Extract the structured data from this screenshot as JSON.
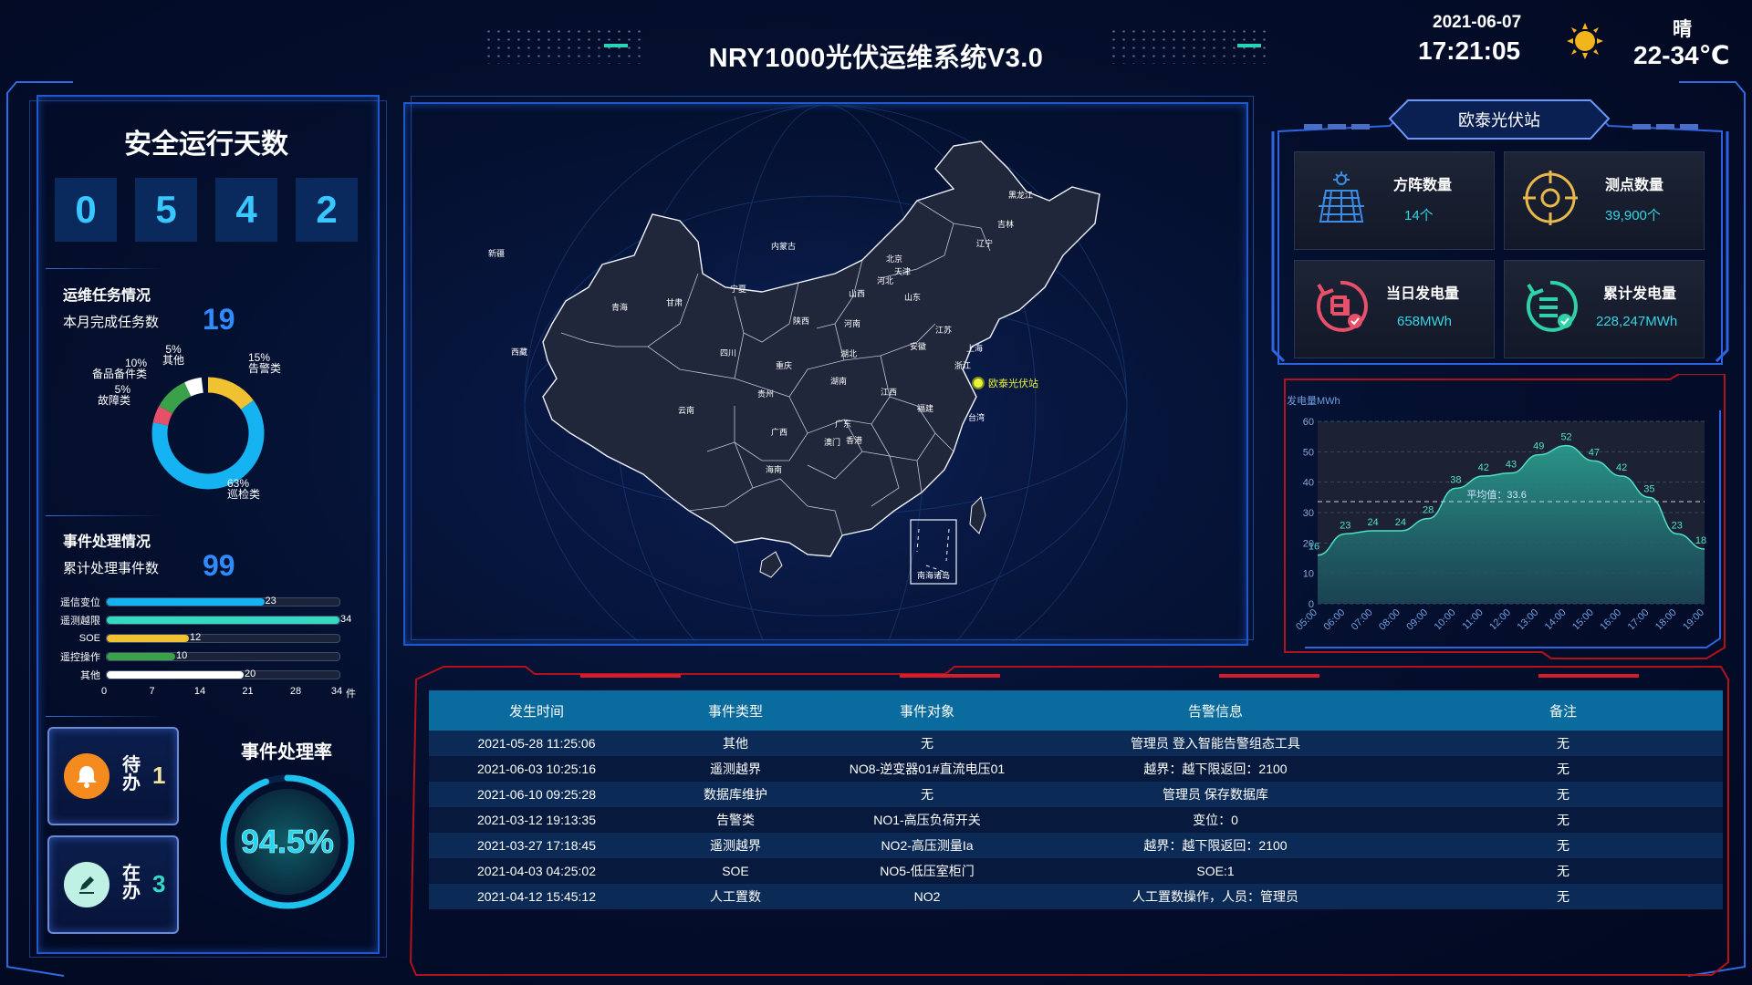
{
  "header": {
    "title": "NRY1000光伏运维系统V3.0",
    "date": "2021-06-07",
    "time": "17:21:05",
    "weather": "晴",
    "temperature": "22-34℃",
    "weather_icon": "sun-icon"
  },
  "safety": {
    "title": "安全运行天数",
    "digits": [
      "0",
      "5",
      "4",
      "2"
    ]
  },
  "tasks": {
    "section_title": "运维任务情况",
    "month_label": "本月完成任务数",
    "month_value": "19",
    "donut": [
      {
        "name": "巡检类",
        "pct": "63%",
        "value": 63,
        "color": "#15b3f2"
      },
      {
        "name": "告警类",
        "pct": "15%",
        "value": 15,
        "color": "#f0c231"
      },
      {
        "name": "其他",
        "pct": "5%",
        "value": 5,
        "color": "#ffffff"
      },
      {
        "name": "备品备件类",
        "pct": "10%",
        "value": 10,
        "color": "#3aa04a"
      },
      {
        "name": "故障类",
        "pct": "5%",
        "value": 5,
        "color": "#e8506a"
      }
    ]
  },
  "events": {
    "section_title": "事件处理情况",
    "total_label": "累计处理事件数",
    "total_value": "99",
    "bars": [
      {
        "name": "遥信变位",
        "value": 23,
        "color": "#15b3f2"
      },
      {
        "name": "遥测越限",
        "value": 34,
        "color": "#35d8c0"
      },
      {
        "name": "SOE",
        "value": 12,
        "color": "#f0c231"
      },
      {
        "name": "遥控操作",
        "value": 10,
        "color": "#3aa04a"
      },
      {
        "name": "其他",
        "value": 20,
        "color": "#ffffff"
      }
    ],
    "axis_ticks": [
      "0",
      "7",
      "14",
      "21",
      "28",
      "34"
    ],
    "axis_unit": "件",
    "axis_max": 34
  },
  "todo": {
    "pending_label": "待办",
    "pending_value": "1",
    "pending_icon": "bell-icon",
    "inprogress_label": "在办",
    "inprogress_value": "3",
    "inprogress_icon": "edit-icon",
    "rate_title": "事件处理率",
    "rate_value": "94.5%",
    "rate": 0.945
  },
  "map": {
    "station_label": "欧泰光伏站",
    "inset_label": "南海诸岛",
    "provinces": [
      {
        "name": "新疆"
      },
      {
        "name": "西藏"
      },
      {
        "name": "青海"
      },
      {
        "name": "甘肃"
      },
      {
        "name": "内蒙古"
      },
      {
        "name": "黑龙江"
      },
      {
        "name": "吉林"
      },
      {
        "name": "辽宁"
      },
      {
        "name": "北京"
      },
      {
        "name": "天津"
      },
      {
        "name": "河北"
      },
      {
        "name": "山西"
      },
      {
        "name": "宁夏"
      },
      {
        "name": "陕西"
      },
      {
        "name": "山东"
      },
      {
        "name": "河南"
      },
      {
        "name": "江苏"
      },
      {
        "name": "安徽"
      },
      {
        "name": "四川"
      },
      {
        "name": "重庆"
      },
      {
        "name": "湖北"
      },
      {
        "name": "浙江"
      },
      {
        "name": "上海"
      },
      {
        "name": "贵州"
      },
      {
        "name": "湖南"
      },
      {
        "name": "江西"
      },
      {
        "name": "福建"
      },
      {
        "name": "云南"
      },
      {
        "name": "广西"
      },
      {
        "name": "广东"
      },
      {
        "name": "台湾"
      },
      {
        "name": "澳门"
      },
      {
        "name": "香港"
      },
      {
        "name": "海南"
      }
    ]
  },
  "station": {
    "title": "欧泰光伏站",
    "cards": [
      {
        "title": "方阵数量",
        "value": "14个",
        "icon": "solar-panel-icon",
        "color": "#3b8ee8"
      },
      {
        "title": "测点数量",
        "value": "39,900个",
        "icon": "target-icon",
        "color": "#e8b84a"
      },
      {
        "title": "当日发电量",
        "value": "658MWh",
        "icon": "daily-energy-icon",
        "color": "#e8506a"
      },
      {
        "title": "累计发电量",
        "value": "228,247MWh",
        "icon": "total-energy-icon",
        "color": "#2fd1a8"
      }
    ]
  },
  "chart_data": {
    "type": "area",
    "ylabel": "发电量MWh",
    "ylim": [
      0,
      60
    ],
    "yticks": [
      "0",
      "10",
      "20",
      "30",
      "40",
      "50",
      "60"
    ],
    "x": [
      "05:00",
      "06:00",
      "07:00",
      "08:00",
      "09:00",
      "10:00",
      "11:00",
      "12:00",
      "13:00",
      "14:00",
      "15:00",
      "16:00",
      "17:00",
      "18:00",
      "19:00"
    ],
    "series": [
      {
        "values": [
          16,
          23,
          24,
          24,
          28,
          38,
          42,
          43,
          49,
          52,
          47,
          42,
          35,
          23,
          18
        ]
      }
    ],
    "average_label": "平均值：33.6",
    "average": 33.6
  },
  "table": {
    "headers": [
      "发生时间",
      "事件类型",
      "事件对象",
      "告警信息",
      "备注"
    ],
    "rows": [
      [
        "2021-05-28 11:25:06",
        "其他",
        "无",
        "管理员 登入智能告警组态工具",
        "无"
      ],
      [
        "2021-06-03 10:25:16",
        "遥测越界",
        "NO8-逆变器01#直流电压01",
        "越界：越下限返回：2100",
        "无"
      ],
      [
        "2021-06-10 09:25:28",
        "数据库维护",
        "无",
        "管理员 保存数据库",
        "无"
      ],
      [
        "2021-03-12 19:13:35",
        "告警类",
        "NO1-高压负荷开关",
        "变位：0",
        "无"
      ],
      [
        "2021-03-27 17:18:45",
        "遥测越界",
        "NO2-高压测量Ia",
        "越界：越下限返回：2100",
        "无"
      ],
      [
        "2021-04-03 04:25:02",
        "SOE",
        "NO5-低压室柜门",
        "SOE:1",
        "无"
      ],
      [
        "2021-04-12 15:45:12",
        "人工置数",
        "NO2",
        "人工置数操作，人员：管理员",
        "无"
      ]
    ]
  }
}
